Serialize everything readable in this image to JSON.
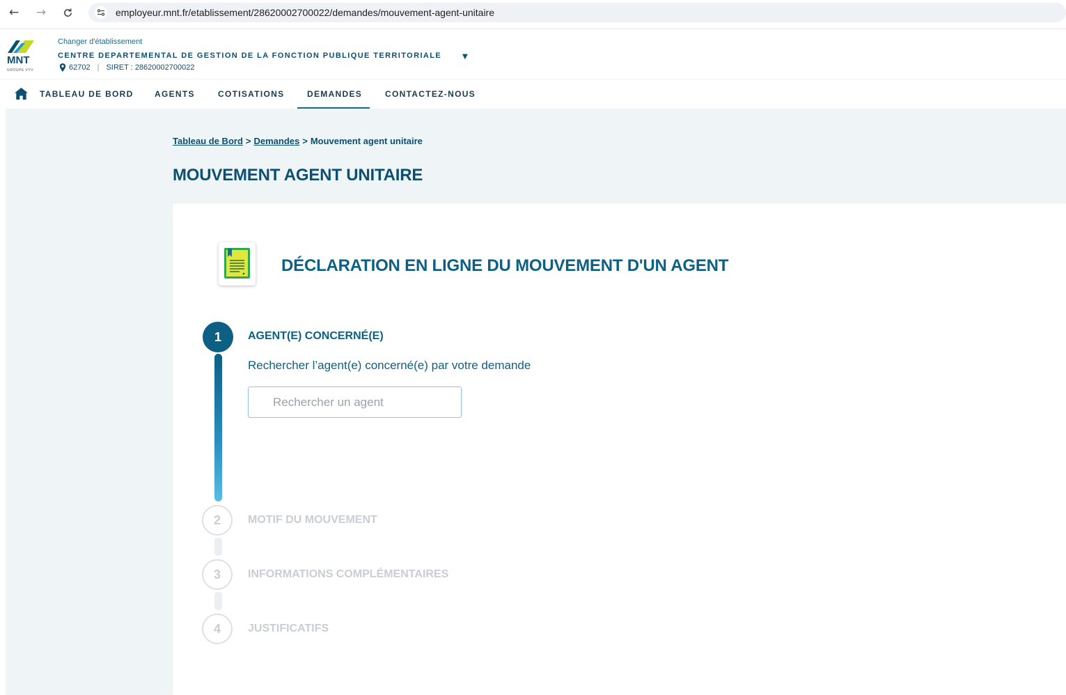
{
  "browser": {
    "url": "employeur.mnt.fr/etablissement/28620002700022/demandes/mouvement-agent-unitaire"
  },
  "header": {
    "logo_text": "MNT",
    "logo_sub": "GROUPE VYV",
    "change_establishment": "Changer d'établissement",
    "establishment_name": "CENTRE DEPARTEMENTAL DE GESTION DE LA FONCTION PUBLIQUE TERRITORIALE",
    "establishment_code": "62702",
    "meta_separator": "|",
    "siret": "SIRET : 28620002700022"
  },
  "nav": {
    "items": [
      {
        "label": "TABLEAU DE BORD"
      },
      {
        "label": "AGENTS"
      },
      {
        "label": "COTISATIONS"
      },
      {
        "label": "DEMANDES"
      },
      {
        "label": "CONTACTEZ-NOUS"
      }
    ],
    "active": "DEMANDES"
  },
  "breadcrumb": {
    "items": [
      "Tableau de Bord",
      "Demandes",
      "Mouvement agent unitaire"
    ],
    "separator": ">"
  },
  "page_title": "MOUVEMENT AGENT UNITAIRE",
  "card": {
    "title": "DÉCLARATION EN LIGNE DU MOUVEMENT D'UN AGENT",
    "steps": [
      {
        "number": "1",
        "label": "AGENT(E) CONCERNÉ(E)",
        "state": "active"
      },
      {
        "number": "2",
        "label": "MOTIF DU MOUVEMENT",
        "state": "inactive"
      },
      {
        "number": "3",
        "label": "INFORMATIONS COMPLÉMENTAIRES",
        "state": "inactive"
      },
      {
        "number": "4",
        "label": "JUSTIFICATIFS",
        "state": "inactive"
      }
    ],
    "search_description": "Rechercher l’agent(e) concerné(e) par votre demande",
    "search_placeholder": "Rechercher un agent",
    "search_value": ""
  },
  "colors": {
    "primary": "#0d5f84",
    "dark_blue": "#0d4f70",
    "page_bg": "#eff4f7",
    "inactive": "#c9ced3"
  }
}
